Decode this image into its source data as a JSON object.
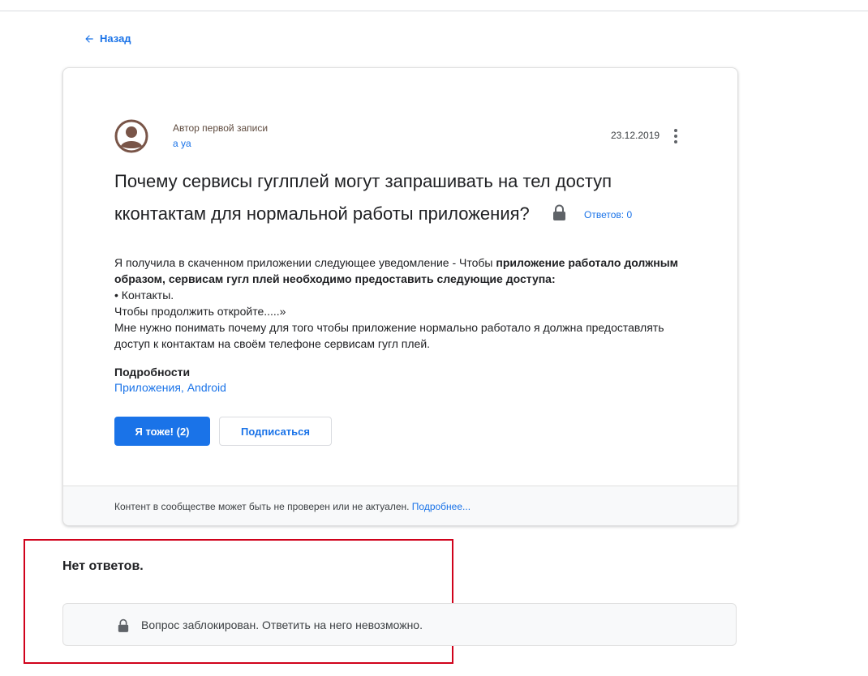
{
  "nav": {
    "back_label": "Назад"
  },
  "post": {
    "author_label": "Автор первой записи",
    "author_name": "a ya",
    "date": "23.12.2019",
    "title_line1": "Почему сервисы гуглплей могут запрашивать на тел доступ",
    "title_line2": "кконтактам для нормальной работы приложения?",
    "replies_label": "Ответов: 0",
    "body": {
      "line1_plain": "Я получила в скаченном приложении следующее уведомление - Чтобы ",
      "line1_bold": "приложение работало должным",
      "line2_bold": "образом, сервисам гугл плей необходимо предоставить следующие доступа:",
      "line3": "• Контакты.",
      "line4": "Чтобы продолжить откройте.....»",
      "line5": "Мне нужно понимать почему для того чтобы приложение нормально работало я должна предоставлять",
      "line6": "доступ к контактам на своём телефоне сервисам гугл плей."
    },
    "details_heading": "Подробности",
    "details_link1": "Приложения",
    "details_separator": ", ",
    "details_link2": "Android",
    "me_too_label": "Я тоже! (2)",
    "subscribe_label": "Подписаться",
    "footer_text": "Контент в сообществе может быть не проверен или не актуален. ",
    "footer_more": "Подробнее..."
  },
  "answers": {
    "no_replies": "Нет ответов.",
    "locked_message": "Вопрос заблокирован. Ответить на него невозможно."
  },
  "icons": {
    "back": "arrow-left-icon",
    "avatar": "account-circle-icon",
    "menu": "more-vert-icon",
    "lock": "lock-icon"
  },
  "colors": {
    "accent": "#1a73e8",
    "highlight_border": "#d0021b",
    "avatar": "#795548"
  }
}
